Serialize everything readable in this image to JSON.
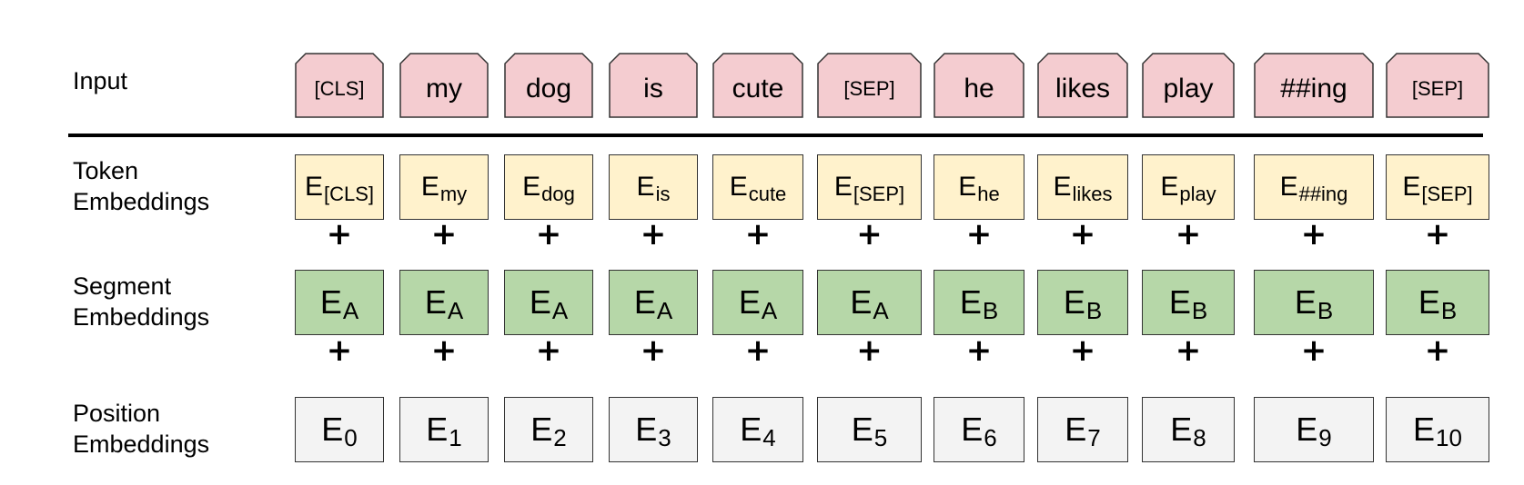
{
  "rows": {
    "input": "Input",
    "token_line1": "Token",
    "token_line2": "Embeddings",
    "segment_line1": "Segment",
    "segment_line2": "Embeddings",
    "position_line1": "Position",
    "position_line2": "Embeddings"
  },
  "plus_symbol": "+",
  "tokens": [
    {
      "input": "[CLS]",
      "token_emb": "E",
      "token_sub": "[CLS]",
      "segment_emb": "E",
      "segment_sub": "A",
      "position_emb": "E",
      "position_sub": "0"
    },
    {
      "input": "my",
      "token_emb": "E",
      "token_sub": "my",
      "segment_emb": "E",
      "segment_sub": "A",
      "position_emb": "E",
      "position_sub": "1"
    },
    {
      "input": "dog",
      "token_emb": "E",
      "token_sub": "dog",
      "segment_emb": "E",
      "segment_sub": "A",
      "position_emb": "E",
      "position_sub": "2"
    },
    {
      "input": "is",
      "token_emb": "E",
      "token_sub": "is",
      "segment_emb": "E",
      "segment_sub": "A",
      "position_emb": "E",
      "position_sub": "3"
    },
    {
      "input": "cute",
      "token_emb": "E",
      "token_sub": "cute",
      "segment_emb": "E",
      "segment_sub": "A",
      "position_emb": "E",
      "position_sub": "4"
    },
    {
      "input": "[SEP]",
      "token_emb": "E",
      "token_sub": "[SEP]",
      "segment_emb": "E",
      "segment_sub": "A",
      "position_emb": "E",
      "position_sub": "5"
    },
    {
      "input": "he",
      "token_emb": "E",
      "token_sub": "he",
      "segment_emb": "E",
      "segment_sub": "B",
      "position_emb": "E",
      "position_sub": "6"
    },
    {
      "input": "likes",
      "token_emb": "E",
      "token_sub": "likes",
      "segment_emb": "E",
      "segment_sub": "B",
      "position_emb": "E",
      "position_sub": "7"
    },
    {
      "input": "play",
      "token_emb": "E",
      "token_sub": "play",
      "segment_emb": "E",
      "segment_sub": "B",
      "position_emb": "E",
      "position_sub": "8"
    },
    {
      "input": "##ing",
      "token_emb": "E",
      "token_sub": "##ing",
      "segment_emb": "E",
      "segment_sub": "B",
      "position_emb": "E",
      "position_sub": "9"
    },
    {
      "input": "[SEP]",
      "token_emb": "E",
      "token_sub": "[SEP]",
      "segment_emb": "E",
      "segment_sub": "B",
      "position_emb": "E",
      "position_sub": "10"
    }
  ],
  "colors": {
    "input_fill": "#f4ccd0",
    "token_fill": "#fff2cc",
    "segment_fill": "#b6d7a8",
    "position_fill": "#f3f3f3"
  }
}
